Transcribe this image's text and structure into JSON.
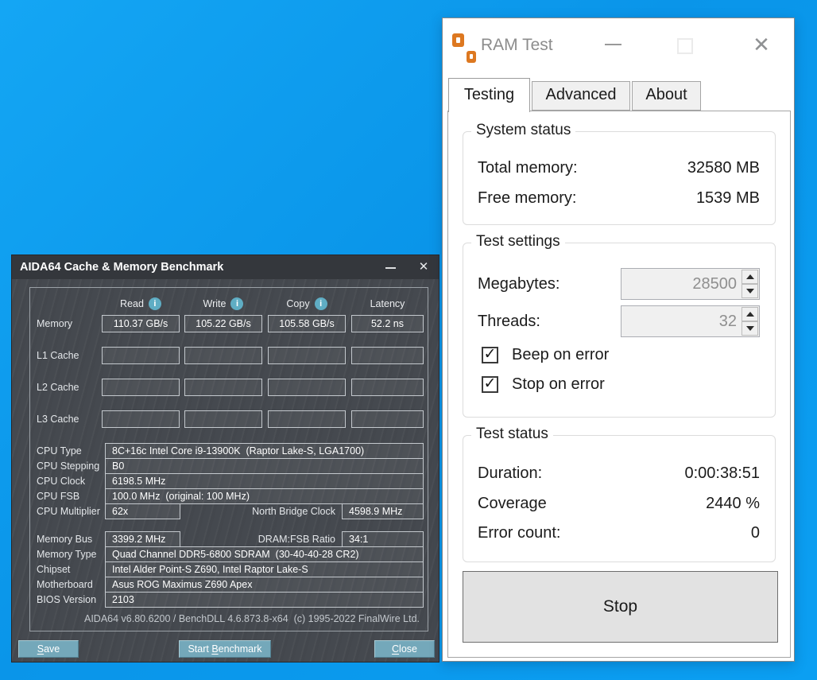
{
  "colors": {
    "desktop_blue": "#0ba0f2",
    "ram_icon_orange": "#dd7820",
    "aida_button_teal": "#74a8ba",
    "info_icon_blue": "#5fadc4",
    "aida_window_bg": "#45494f",
    "aida_titlebar_bg": "#34373c"
  },
  "glyphs": {
    "close": "✕",
    "check": "✓",
    "info": "i"
  },
  "aida": {
    "title": "AIDA64 Cache & Memory Benchmark",
    "header": {
      "read": "Read",
      "write": "Write",
      "copy": "Copy",
      "latency": "Latency"
    },
    "bench_rows": [
      {
        "label": "Memory",
        "values": [
          "110.37 GB/s",
          "105.22 GB/s",
          "105.58 GB/s",
          "52.2 ns"
        ]
      },
      {
        "label": "L1 Cache",
        "values": [
          "",
          "",
          "",
          ""
        ]
      },
      {
        "label": "L2 Cache",
        "values": [
          "",
          "",
          "",
          ""
        ]
      },
      {
        "label": "L3 Cache",
        "values": [
          "",
          "",
          "",
          ""
        ]
      }
    ],
    "cpu_info": {
      "rows": [
        {
          "label": "CPU Type",
          "value": "8C+16c Intel Core i9-13900K  (Raptor Lake-S, LGA1700)"
        },
        {
          "label": "CPU Stepping",
          "value": "B0"
        },
        {
          "label": "CPU Clock",
          "value": "6198.5 MHz"
        },
        {
          "label": "CPU FSB",
          "value": "100.0 MHz  (original: 100 MHz)"
        },
        {
          "label": "CPU Multiplier",
          "value": "62x"
        }
      ],
      "north_bridge_label": "North Bridge Clock",
      "north_bridge_value": "4598.9 MHz"
    },
    "mem_info": {
      "rows": [
        {
          "label": "Memory Bus",
          "value": "3399.2 MHz"
        },
        {
          "label": "Memory Type",
          "value": "Quad Channel DDR5-6800 SDRAM  (30-40-40-28 CR2)"
        },
        {
          "label": "Chipset",
          "value": "Intel Alder Point-S Z690, Intel Raptor Lake-S"
        },
        {
          "label": "Motherboard",
          "value": "Asus ROG Maximus Z690 Apex"
        },
        {
          "label": "BIOS Version",
          "value": "2103"
        }
      ],
      "dram_fsb_label": "DRAM:FSB Ratio",
      "dram_fsb_value": "34:1"
    },
    "footer": "AIDA64 v6.80.6200 / BenchDLL 4.6.873.8-x64  (c) 1995-2022 FinalWire Ltd.",
    "buttons": {
      "save": "Save",
      "start": "Start Benchmark",
      "close": "Close"
    }
  },
  "ram": {
    "title": "RAM Test",
    "tabs": [
      "Testing",
      "Advanced",
      "About"
    ],
    "system_status": {
      "legend": "System status",
      "total_label": "Total memory:",
      "total_value": "32580 MB",
      "free_label": "Free memory:",
      "free_value": "1539 MB"
    },
    "test_settings": {
      "legend": "Test settings",
      "megabytes_label": "Megabytes:",
      "megabytes_value": "28500",
      "threads_label": "Threads:",
      "threads_value": "32",
      "beep_label": "Beep on error",
      "beep_checked": true,
      "stop_label": "Stop on error",
      "stop_checked": true
    },
    "test_status": {
      "legend": "Test status",
      "duration_label": "Duration:",
      "duration_value": "0:00:38:51",
      "coverage_label": "Coverage",
      "coverage_value": "2440 %",
      "errors_label": "Error count:",
      "errors_value": "0"
    },
    "stop_button": "Stop"
  }
}
